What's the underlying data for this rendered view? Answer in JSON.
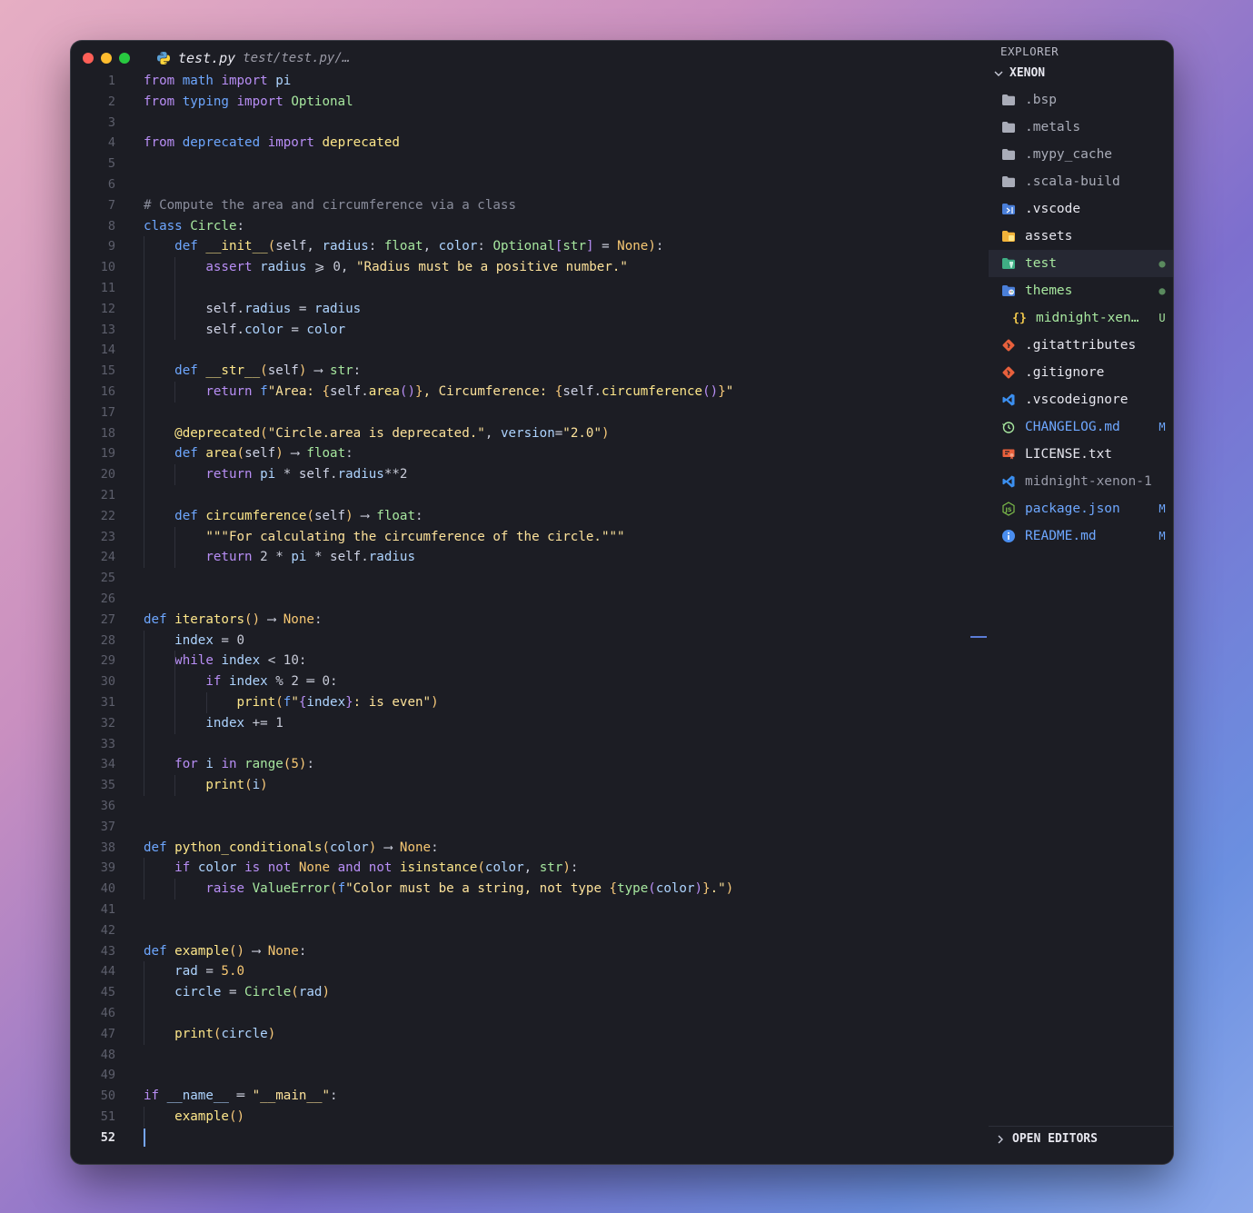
{
  "tab": {
    "filename": "test.py",
    "path": "test/test.py/…"
  },
  "explorer": {
    "title": "EXPLORER",
    "root": "XENON",
    "items": [
      {
        "label": ".bsp",
        "icon": "folder-icon",
        "color": "#a9acb8",
        "status": ""
      },
      {
        "label": ".metals",
        "icon": "folder-icon",
        "color": "#a9acb8",
        "status": ""
      },
      {
        "label": ".mypy_cache",
        "icon": "folder-icon",
        "color": "#a9acb8",
        "status": ""
      },
      {
        "label": ".scala-build",
        "icon": "folder-icon",
        "color": "#a9acb8",
        "status": ""
      },
      {
        "label": ".vscode",
        "icon": "vscode-folder-icon",
        "color": "#e6e6ee",
        "status": ""
      },
      {
        "label": "assets",
        "icon": "assets-folder-icon",
        "color": "#e6e6ee",
        "status": ""
      },
      {
        "label": "test",
        "icon": "test-folder-icon",
        "color": "#a7e79f",
        "status": "●"
      },
      {
        "label": "themes",
        "icon": "themes-folder-icon",
        "color": "#a7e79f",
        "status": "●"
      },
      {
        "label": "midnight-xen…",
        "icon": "json-braces-icon",
        "color": "#a7e79f",
        "status": "U"
      },
      {
        "label": ".gitattributes",
        "icon": "git-icon",
        "color": "#e6e6ee",
        "status": ""
      },
      {
        "label": ".gitignore",
        "icon": "git-icon",
        "color": "#e6e6ee",
        "status": ""
      },
      {
        "label": ".vscodeignore",
        "icon": "vscode-icon",
        "color": "#e6e6ee",
        "status": ""
      },
      {
        "label": "CHANGELOG.md",
        "icon": "changelog-icon",
        "color": "#6ea7ff",
        "status": "M"
      },
      {
        "label": "LICENSE.txt",
        "icon": "license-icon",
        "color": "#e6e6ee",
        "status": ""
      },
      {
        "label": "midnight-xenon-1.…",
        "icon": "vscode-icon",
        "color": "#9a9caa",
        "status": ""
      },
      {
        "label": "package.json",
        "icon": "nodejs-icon",
        "color": "#6ea7ff",
        "status": "M"
      },
      {
        "label": "README.md",
        "icon": "info-icon",
        "color": "#6ea7ff",
        "status": "M"
      }
    ],
    "open_editors": "OPEN EDITORS"
  },
  "editor": {
    "current_line": 52,
    "lines": [
      [
        [
          "k",
          "from"
        ],
        [
          "o",
          " "
        ],
        [
          "kb",
          "math"
        ],
        [
          "o",
          " "
        ],
        [
          "k",
          "import"
        ],
        [
          "o",
          " "
        ],
        [
          "v",
          "pi"
        ]
      ],
      [
        [
          "k",
          "from"
        ],
        [
          "o",
          " "
        ],
        [
          "kb",
          "typing"
        ],
        [
          "o",
          " "
        ],
        [
          "k",
          "import"
        ],
        [
          "o",
          " "
        ],
        [
          "t",
          "Optional"
        ]
      ],
      [],
      [
        [
          "k",
          "from"
        ],
        [
          "o",
          " "
        ],
        [
          "kb",
          "deprecated"
        ],
        [
          "o",
          " "
        ],
        [
          "k",
          "import"
        ],
        [
          "o",
          " "
        ],
        [
          "f",
          "deprecated"
        ]
      ],
      [],
      [],
      [
        [
          "c",
          "# Compute the area and circumference via a class"
        ]
      ],
      [
        [
          "kb",
          "class"
        ],
        [
          "o",
          " "
        ],
        [
          "cls",
          "Circle"
        ],
        [
          "o",
          ":"
        ]
      ],
      [
        [
          "o",
          "    "
        ],
        [
          "kb",
          "def"
        ],
        [
          "o",
          " "
        ],
        [
          "f",
          "__init__"
        ],
        [
          "p",
          "("
        ],
        [
          "b",
          "self"
        ],
        [
          "o",
          ", "
        ],
        [
          "v",
          "radius"
        ],
        [
          "o",
          ": "
        ],
        [
          "t",
          "float"
        ],
        [
          "o",
          ", "
        ],
        [
          "v",
          "color"
        ],
        [
          "o",
          ": "
        ],
        [
          "t",
          "Optional"
        ],
        [
          "k",
          "["
        ],
        [
          "t",
          "str"
        ],
        [
          "k",
          "]"
        ],
        [
          "o",
          " = "
        ],
        [
          "n",
          "None"
        ],
        [
          "p",
          ")"
        ],
        [
          "o",
          ":"
        ]
      ],
      [
        [
          "o",
          "        "
        ],
        [
          "k",
          "assert"
        ],
        [
          "o",
          " "
        ],
        [
          "v",
          "radius"
        ],
        [
          "o",
          " ⩾ 0, "
        ],
        [
          "s",
          "\"Radius must be a positive number.\""
        ]
      ],
      [],
      [
        [
          "o",
          "        "
        ],
        [
          "b",
          "self"
        ],
        [
          "o",
          "."
        ],
        [
          "v",
          "radius"
        ],
        [
          "o",
          " = "
        ],
        [
          "v",
          "radius"
        ]
      ],
      [
        [
          "o",
          "        "
        ],
        [
          "b",
          "self"
        ],
        [
          "o",
          "."
        ],
        [
          "v",
          "color"
        ],
        [
          "o",
          " = "
        ],
        [
          "v",
          "color"
        ]
      ],
      [],
      [
        [
          "o",
          "    "
        ],
        [
          "kb",
          "def"
        ],
        [
          "o",
          " "
        ],
        [
          "f",
          "__str__"
        ],
        [
          "p",
          "("
        ],
        [
          "b",
          "self"
        ],
        [
          "p",
          ")"
        ],
        [
          "o",
          " ⟶ "
        ],
        [
          "t",
          "str"
        ],
        [
          "o",
          ":"
        ]
      ],
      [
        [
          "o",
          "        "
        ],
        [
          "k",
          "return"
        ],
        [
          "o",
          " "
        ],
        [
          "kb",
          "f"
        ],
        [
          "s",
          "\"Area: "
        ],
        [
          "p",
          "{"
        ],
        [
          "b",
          "self"
        ],
        [
          "o",
          "."
        ],
        [
          "f",
          "area"
        ],
        [
          "k",
          "()"
        ],
        [
          "p",
          "}"
        ],
        [
          "s",
          ", Circumference: "
        ],
        [
          "p",
          "{"
        ],
        [
          "b",
          "self"
        ],
        [
          "o",
          "."
        ],
        [
          "f",
          "circumference"
        ],
        [
          "k",
          "()"
        ],
        [
          "p",
          "}"
        ],
        [
          "s",
          "\""
        ]
      ],
      [],
      [
        [
          "o",
          "    "
        ],
        [
          "f",
          "@deprecated"
        ],
        [
          "p",
          "("
        ],
        [
          "s",
          "\"Circle.area is deprecated.\""
        ],
        [
          "o",
          ", "
        ],
        [
          "v",
          "version"
        ],
        [
          "o",
          "="
        ],
        [
          "s",
          "\"2.0\""
        ],
        [
          "p",
          ")"
        ]
      ],
      [
        [
          "o",
          "    "
        ],
        [
          "kb",
          "def"
        ],
        [
          "o",
          " "
        ],
        [
          "f",
          "area"
        ],
        [
          "p",
          "("
        ],
        [
          "b",
          "self"
        ],
        [
          "p",
          ")"
        ],
        [
          "o",
          " ⟶ "
        ],
        [
          "t",
          "float"
        ],
        [
          "o",
          ":"
        ]
      ],
      [
        [
          "o",
          "        "
        ],
        [
          "k",
          "return"
        ],
        [
          "o",
          " "
        ],
        [
          "v",
          "pi"
        ],
        [
          "o",
          " * "
        ],
        [
          "b",
          "self"
        ],
        [
          "o",
          "."
        ],
        [
          "v",
          "radius"
        ],
        [
          "o",
          "**2"
        ]
      ],
      [],
      [
        [
          "o",
          "    "
        ],
        [
          "kb",
          "def"
        ],
        [
          "o",
          " "
        ],
        [
          "f",
          "circumference"
        ],
        [
          "p",
          "("
        ],
        [
          "b",
          "self"
        ],
        [
          "p",
          ")"
        ],
        [
          "o",
          " ⟶ "
        ],
        [
          "t",
          "float"
        ],
        [
          "o",
          ":"
        ]
      ],
      [
        [
          "o",
          "        "
        ],
        [
          "s",
          "\"\"\"For calculating the circumference of the circle.\"\"\""
        ]
      ],
      [
        [
          "o",
          "        "
        ],
        [
          "k",
          "return"
        ],
        [
          "o",
          " 2 * "
        ],
        [
          "v",
          "pi"
        ],
        [
          "o",
          " * "
        ],
        [
          "b",
          "self"
        ],
        [
          "o",
          "."
        ],
        [
          "v",
          "radius"
        ]
      ],
      [],
      [],
      [
        [
          "kb",
          "def"
        ],
        [
          "o",
          " "
        ],
        [
          "f",
          "iterators"
        ],
        [
          "p",
          "()"
        ],
        [
          "o",
          " ⟶ "
        ],
        [
          "n",
          "None"
        ],
        [
          "o",
          ":"
        ]
      ],
      [
        [
          "o",
          "    "
        ],
        [
          "v",
          "index"
        ],
        [
          "o",
          " = 0"
        ]
      ],
      [
        [
          "o",
          "    "
        ],
        [
          "k",
          "while"
        ],
        [
          "o",
          " "
        ],
        [
          "v",
          "index"
        ],
        [
          "o",
          " < 10:"
        ]
      ],
      [
        [
          "o",
          "        "
        ],
        [
          "k",
          "if"
        ],
        [
          "o",
          " "
        ],
        [
          "v",
          "index"
        ],
        [
          "o",
          " % 2 ═ 0:"
        ]
      ],
      [
        [
          "o",
          "            "
        ],
        [
          "f",
          "print"
        ],
        [
          "p",
          "("
        ],
        [
          "kb",
          "f"
        ],
        [
          "s",
          "\""
        ],
        [
          "k",
          "{"
        ],
        [
          "v",
          "index"
        ],
        [
          "k",
          "}"
        ],
        [
          "s",
          ": is even\""
        ],
        [
          "p",
          ")"
        ]
      ],
      [
        [
          "o",
          "        "
        ],
        [
          "v",
          "index"
        ],
        [
          "o",
          " += 1"
        ]
      ],
      [],
      [
        [
          "o",
          "    "
        ],
        [
          "k",
          "for"
        ],
        [
          "o",
          " "
        ],
        [
          "v",
          "i"
        ],
        [
          "o",
          " "
        ],
        [
          "k",
          "in"
        ],
        [
          "o",
          " "
        ],
        [
          "t",
          "range"
        ],
        [
          "p",
          "("
        ],
        [
          "n",
          "5"
        ],
        [
          "p",
          ")"
        ],
        [
          "o",
          ":"
        ]
      ],
      [
        [
          "o",
          "        "
        ],
        [
          "f",
          "print"
        ],
        [
          "p",
          "("
        ],
        [
          "v",
          "i"
        ],
        [
          "p",
          ")"
        ]
      ],
      [],
      [],
      [
        [
          "kb",
          "def"
        ],
        [
          "o",
          " "
        ],
        [
          "f",
          "python_conditionals"
        ],
        [
          "p",
          "("
        ],
        [
          "v",
          "color"
        ],
        [
          "p",
          ")"
        ],
        [
          "o",
          " ⟶ "
        ],
        [
          "n",
          "None"
        ],
        [
          "o",
          ":"
        ]
      ],
      [
        [
          "o",
          "    "
        ],
        [
          "k",
          "if"
        ],
        [
          "o",
          " "
        ],
        [
          "v",
          "color"
        ],
        [
          "o",
          " "
        ],
        [
          "k",
          "is"
        ],
        [
          "o",
          " "
        ],
        [
          "k",
          "not"
        ],
        [
          "o",
          " "
        ],
        [
          "n",
          "None"
        ],
        [
          "o",
          " "
        ],
        [
          "k",
          "and"
        ],
        [
          "o",
          " "
        ],
        [
          "k",
          "not"
        ],
        [
          "o",
          " "
        ],
        [
          "f",
          "isinstance"
        ],
        [
          "p",
          "("
        ],
        [
          "v",
          "color"
        ],
        [
          "o",
          ", "
        ],
        [
          "t",
          "str"
        ],
        [
          "p",
          ")"
        ],
        [
          "o",
          ":"
        ]
      ],
      [
        [
          "o",
          "        "
        ],
        [
          "k",
          "raise"
        ],
        [
          "o",
          " "
        ],
        [
          "cls",
          "ValueError"
        ],
        [
          "p",
          "("
        ],
        [
          "kb",
          "f"
        ],
        [
          "s",
          "\"Color must be a string, not type "
        ],
        [
          "p",
          "{"
        ],
        [
          "t",
          "type"
        ],
        [
          "k",
          "("
        ],
        [
          "v",
          "color"
        ],
        [
          "k",
          ")"
        ],
        [
          "p",
          "}"
        ],
        [
          "s",
          ".\""
        ],
        [
          "p",
          ")"
        ]
      ],
      [],
      [],
      [
        [
          "kb",
          "def"
        ],
        [
          "o",
          " "
        ],
        [
          "f",
          "example"
        ],
        [
          "p",
          "()"
        ],
        [
          "o",
          " ⟶ "
        ],
        [
          "n",
          "None"
        ],
        [
          "o",
          ":"
        ]
      ],
      [
        [
          "o",
          "    "
        ],
        [
          "v",
          "rad"
        ],
        [
          "o",
          " = "
        ],
        [
          "n",
          "5.0"
        ]
      ],
      [
        [
          "o",
          "    "
        ],
        [
          "v",
          "circle"
        ],
        [
          "o",
          " = "
        ],
        [
          "cls",
          "Circle"
        ],
        [
          "p",
          "("
        ],
        [
          "v",
          "rad"
        ],
        [
          "p",
          ")"
        ]
      ],
      [],
      [
        [
          "o",
          "    "
        ],
        [
          "f",
          "print"
        ],
        [
          "p",
          "("
        ],
        [
          "v",
          "circle"
        ],
        [
          "p",
          ")"
        ]
      ],
      [],
      [],
      [
        [
          "k",
          "if"
        ],
        [
          "o",
          " "
        ],
        [
          "v",
          "__name__"
        ],
        [
          "o",
          " ═ "
        ],
        [
          "s",
          "\"__main__\""
        ],
        [
          "o",
          ":"
        ]
      ],
      [
        [
          "o",
          "    "
        ],
        [
          "f",
          "example"
        ],
        [
          "p",
          "()"
        ]
      ],
      []
    ]
  }
}
